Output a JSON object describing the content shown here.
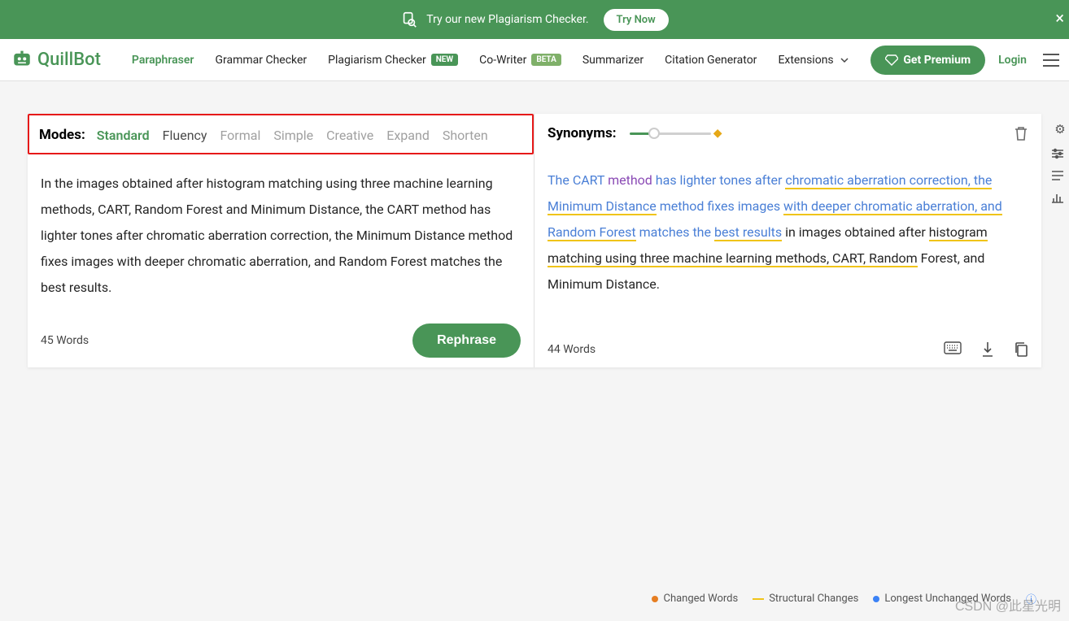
{
  "banner": {
    "text": "Try our new Plagiarism Checker.",
    "cta": "Try Now"
  },
  "brand": "QuillBot",
  "nav": {
    "items": [
      {
        "label": "Paraphraser",
        "active": true
      },
      {
        "label": "Grammar Checker"
      },
      {
        "label": "Plagiarism Checker",
        "badge": "NEW"
      },
      {
        "label": "Co-Writer",
        "badge": "BETA"
      },
      {
        "label": "Summarizer"
      },
      {
        "label": "Citation Generator"
      },
      {
        "label": "Extensions",
        "dropdown": true
      }
    ],
    "premium": "Get Premium",
    "login": "Login"
  },
  "modes": {
    "label": "Modes:",
    "items": [
      "Standard",
      "Fluency",
      "Formal",
      "Simple",
      "Creative",
      "Expand",
      "Shorten"
    ],
    "active": "Standard",
    "enabled": [
      "Standard",
      "Fluency"
    ]
  },
  "synonyms": {
    "label": "Synonyms:"
  },
  "input": {
    "text": "In the images obtained after histogram matching using three machine learning methods, CART, Random Forest and Minimum Distance, the CART method has lighter tones after chromatic aberration correction, the Minimum Distance method fixes images with deeper chromatic aberration, and Random Forest matches the best results.",
    "word_count": "45 Words",
    "action": "Rephrase"
  },
  "output": {
    "segments": [
      {
        "text": "The CART ",
        "cls": "out-blue"
      },
      {
        "text": "method",
        "cls": "out-orange"
      },
      {
        "text": " has lighter tones after ",
        "cls": "out-blue"
      },
      {
        "text": "chromatic aberration correction, the Minimum Distance",
        "cls": "out-blue ul-yellow"
      },
      {
        "text": " method fixes images ",
        "cls": "out-blue"
      },
      {
        "text": "with deeper chromatic aberration, and Random Forest",
        "cls": "out-blue ul-yellow"
      },
      {
        "text": " matches the ",
        "cls": "out-blue"
      },
      {
        "text": "best results",
        "cls": "out-blue ul-yellow"
      },
      {
        "text": " in images obtained after ",
        "cls": ""
      },
      {
        "text": "histogram matching using three machine learning methods, CART, Random",
        "cls": "ul-yellow"
      },
      {
        "text": " Forest, and Minimum Distance.",
        "cls": ""
      }
    ],
    "word_count": "44 Words"
  },
  "legend": {
    "changed": "Changed Words",
    "structural": "Structural Changes",
    "longest": "Longest Unchanged Words"
  },
  "watermark": "CSDN @此星光明"
}
